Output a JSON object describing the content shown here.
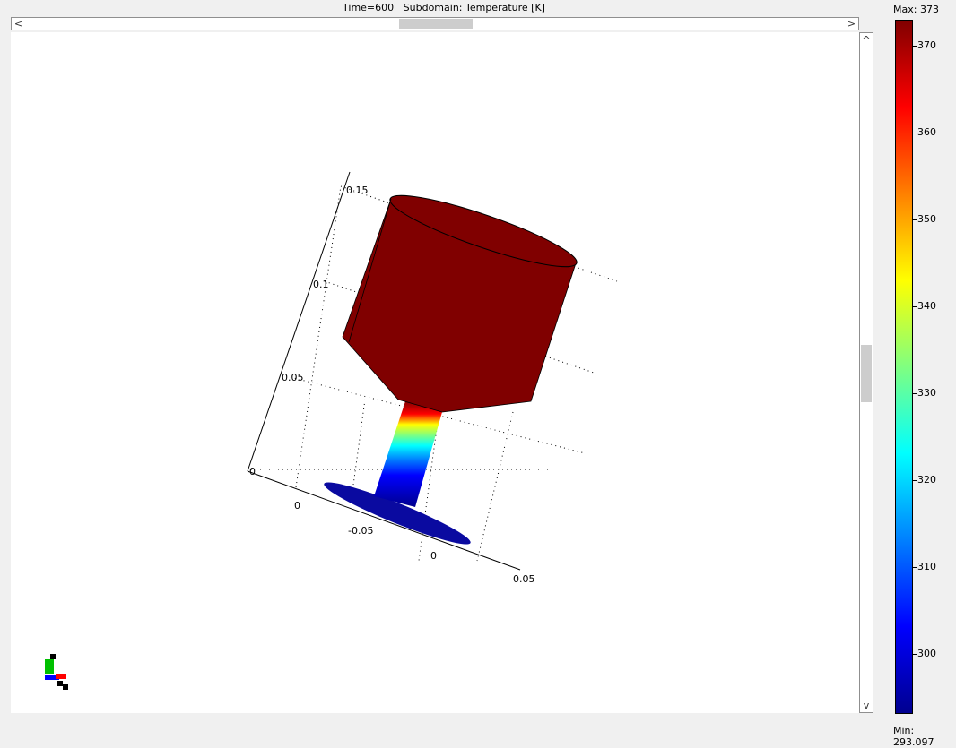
{
  "header": {
    "time_label": "Time=600",
    "subdomain_label": "Subdomain: Temperature [K]"
  },
  "scrollbars": {
    "left_arrow": "<",
    "right_arrow": ">",
    "up_arrow": "^",
    "down_arrow": "v"
  },
  "plot": {
    "z_ticks": [
      "0",
      "0.05",
      "0.1",
      "0.15"
    ],
    "x_ticks": [
      "0",
      "-0.05"
    ],
    "y_ticks": [
      "0",
      "0.05"
    ],
    "axis_triad_colors": {
      "x": "#ff0000",
      "y": "#00c000",
      "z": "#0000ff"
    }
  },
  "colorbar": {
    "max_label": "Max: 373",
    "min_label": "Min: 293.097",
    "min": 293.097,
    "max": 373,
    "ticks": [
      "370",
      "360",
      "350",
      "340",
      "330",
      "320",
      "310",
      "300"
    ],
    "colormap": "jet"
  }
}
